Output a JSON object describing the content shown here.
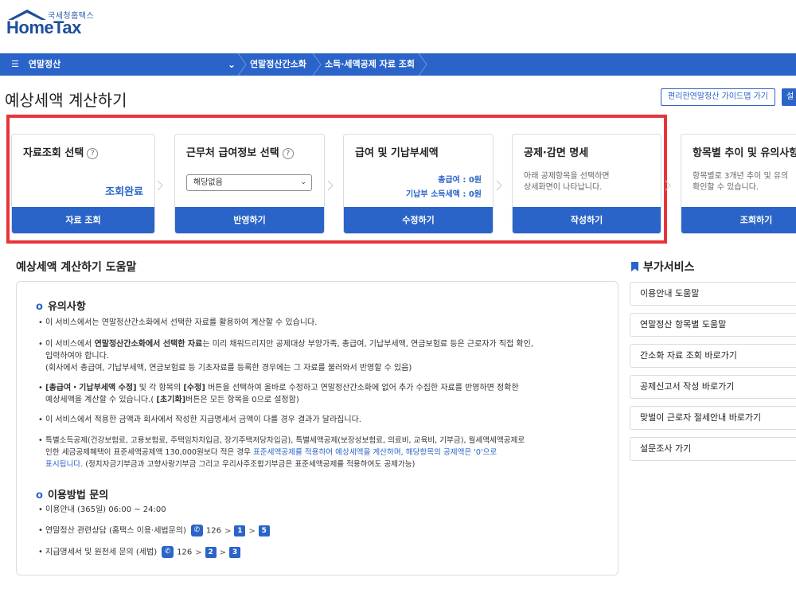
{
  "logo": {
    "small": "국세청홈택스",
    "big": "HomeTax"
  },
  "nav": {
    "menu_icon": "hamburger-icon",
    "menu_label": "연말정산",
    "crumbs": [
      "연말정산간소화",
      "소득·세액공제 자료 조회"
    ]
  },
  "page": {
    "title": "예상세액 계산하기",
    "guide_button": "편리한연말정산 가이드맵 가기",
    "settings_button": "설"
  },
  "steps": [
    {
      "title": "자료조회 선택",
      "help": "?",
      "status": "조회완료",
      "button": "자료 조회"
    },
    {
      "title": "근무처 급여정보 선택",
      "help": "?",
      "select_value": "해당없음",
      "button": "반영하기"
    },
    {
      "title": "급여 및 기납부세액",
      "total_pay": "총급여 : 0원",
      "prepaid_tax": "기납부 소득세액 : 0원",
      "button": "수정하기"
    },
    {
      "title": "공제·감면 명세",
      "desc_line1": "아래 공제항목을 선택하면",
      "desc_line2": "상세화면이 나타납니다.",
      "button": "작성하기"
    },
    {
      "title": "항목별 추이 및 유의사항",
      "desc_line1": "항목별로 3개년 추이 및 유의",
      "desc_line2": "확인할 수 있습니다.",
      "button": "조회하기"
    }
  ],
  "help": {
    "title": "예상세액 계산하기 도움말",
    "notes_title": "유의사항",
    "notes": {
      "n1": "이 서비스에서는 연말정산간소화에서 선택한 자료를 활용하여 계산할 수 있습니다.",
      "n2_a": "이 서비스에서 ",
      "n2_b": "연말정산간소화에서 선택한 자료",
      "n2_c": "는 미리 채워드리지만 공제대상 부양가족, 총급여, 기납부세액, 연금보험료 등은 근로자가 직접 확인,",
      "n2_d": "입력하여야 합니다.",
      "n2_e": "(회사에서 총급여, 기납부세액, 연금보험료 등 기초자료를 등록한 경우에는 그 자료를 불러와서 반영할 수 있음)",
      "n3_a": "[총급여・기납부세액 수정]",
      "n3_b": " 및 각 항목의 ",
      "n3_c": "[수정]",
      "n3_d": " 버튼을 선택하여 올바로 수정하고 연말정산간소화에 없어 추가 수집한 자료를 반영하면 정확한",
      "n3_e": "예상세액을 계산할 수 있습니다.( ",
      "n3_f": "[초기화]",
      "n3_g": "버튼은 모든 항목을 0으로 설정함)",
      "n4": "이 서비스에서 적용한 금액과 회사에서 작성한 지급명세서 금액이 다를 경우 결과가 달라집니다.",
      "n5_a": "특별소득공제(건강보험료, 고용보험료, 주택임차차입금, 장기주택저당차입금), 특별세액공제(보장성보험료, 의료비, 교육비, 기부금), 월세액세액공제로",
      "n5_b": "인한 세금공제혜택이 표준세액공제액 130,000원보다 적은 경우 ",
      "n5_c": "표준세액공제를 적용하여 예상세액을 계산하며, 해당항목의 공제액은 '0'으로",
      "n5_d": "표시됩니다.",
      "n5_e": " (정치자금기부금과 고향사랑기부금 그리고 우리사주조합기부금은 표준세액공제를 적용하여도 공제가능)"
    },
    "contact_title": "이용방법 문의",
    "contact": {
      "hours": "이용안내 (365일) 06:00 ~ 24:00",
      "c1_label": "연말정산 관련상담 (홈택스 이용·세법문의)",
      "c1_num": "126",
      "c1_s1": "1",
      "c1_s2": "5",
      "c2_label": "지급명세서 및 원천세 문의 (세법)",
      "c2_num": "126",
      "c2_s1": "2",
      "c2_s2": "3",
      "gt": ">"
    }
  },
  "side": {
    "title": "부가서비스",
    "items": [
      "이용안내 도움말",
      "연말정산 항목별 도움말",
      "간소화 자료 조회 바로가기",
      "공제신고서 작성 바로가기",
      "맞벌이 근로자 절세안내 바로가기",
      "설문조사 가기"
    ]
  },
  "colors": {
    "accent": "#2b64c8",
    "highlight": "#e8343a"
  }
}
